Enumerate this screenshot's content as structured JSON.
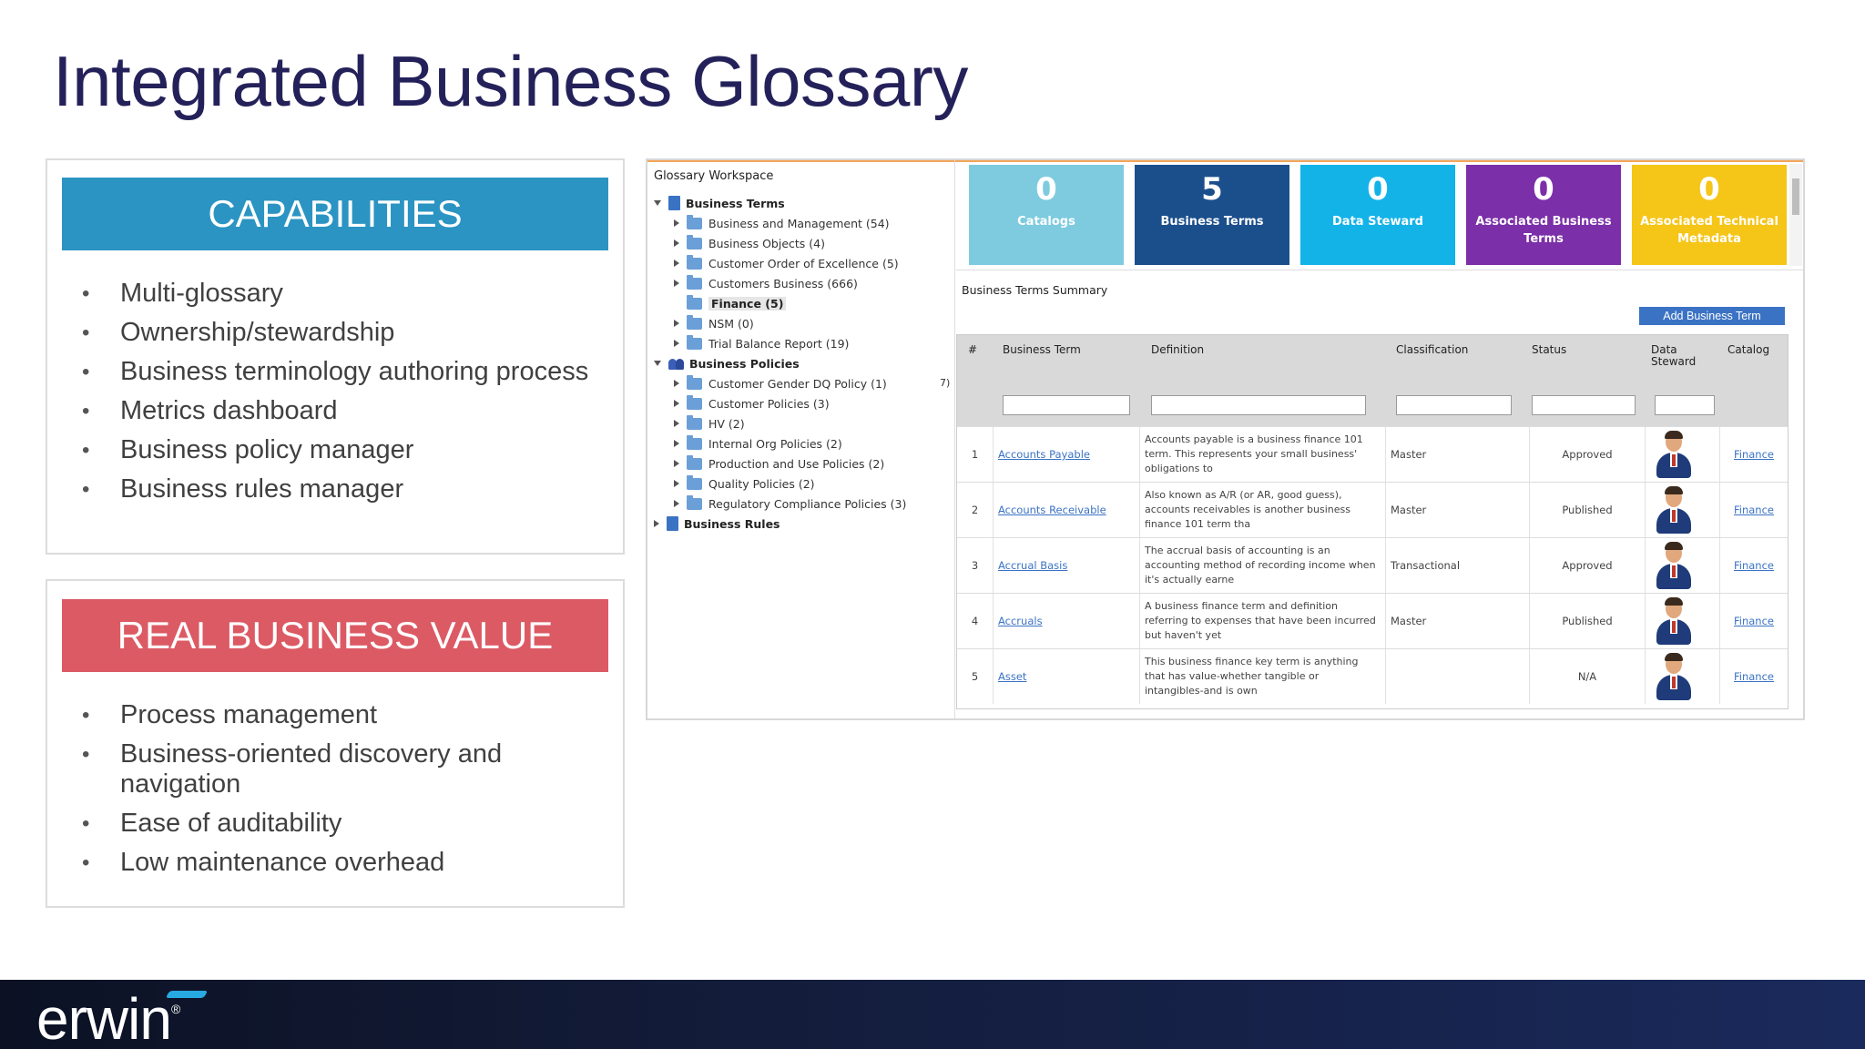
{
  "slide": {
    "title": "Integrated Business Glossary",
    "capabilities": {
      "heading": "CAPABILITIES",
      "color": "#2b94c3",
      "items": [
        "Multi-glossary",
        "Ownership/stewardship",
        "Business terminology authoring process",
        "Metrics dashboard",
        "Business policy manager",
        "Business rules manager"
      ]
    },
    "value": {
      "heading": "REAL BUSINESS VALUE",
      "color": "#dc5a64",
      "items": [
        "Process management",
        "Business-oriented discovery and navigation",
        "Ease of auditability",
        "Low maintenance overhead"
      ]
    },
    "logo": "erwin"
  },
  "app": {
    "tree": {
      "title": "Glossary Workspace",
      "business_terms": {
        "label": "Business Terms",
        "children": [
          "Business and Management (54)",
          "Business Objects (4)",
          "Customer Order of Excellence (5)",
          "Customers Business (666)",
          "Finance (5)",
          "NSM (0)",
          "Trial Balance Report (19)"
        ]
      },
      "business_policies": {
        "label": "Business Policies",
        "children": [
          "Customer Gender DQ Policy (1)",
          "Customer Policies (3)",
          "HV (2)",
          "Internal Org Policies (2)",
          "Production and Use Policies (2)",
          "Quality Policies (2)",
          "Regulatory Compliance Policies (3)"
        ]
      },
      "business_rules": {
        "label": "Business Rules"
      },
      "stray_text": "7)"
    },
    "cards": [
      {
        "count": "0",
        "label": "Catalogs",
        "color": "#7ecbe0"
      },
      {
        "count": "5",
        "label": "Business Terms",
        "color": "#1b4f8c"
      },
      {
        "count": "0",
        "label": "Data Steward",
        "color": "#13b3e8"
      },
      {
        "count": "0",
        "label": "Associated Business Terms",
        "color": "#7b2fa8"
      },
      {
        "count": "0",
        "label": "Associated Technical Metadata",
        "color": "#f5c518"
      }
    ],
    "summary": {
      "title": "Business Terms Summary",
      "add_button": "Add Business Term",
      "columns": {
        "num": "#",
        "term": "Business Term",
        "definition": "Definition",
        "classification": "Classification",
        "status": "Status",
        "steward_line1": "Data",
        "steward_line2": "Steward",
        "catalog": "Catalog"
      },
      "rows": [
        {
          "num": "1",
          "term": "Accounts Payable",
          "definition": "Accounts payable is a business finance 101 term. This represents your small business' obligations to",
          "classification": "Master",
          "status": "Approved",
          "catalog": "Finance"
        },
        {
          "num": "2",
          "term": "Accounts Receivable",
          "definition": "Also known as A/R (or AR, good guess), accounts receivables is another business finance 101 term tha",
          "classification": "Master",
          "status": "Published",
          "catalog": "Finance"
        },
        {
          "num": "3",
          "term": "Accrual Basis",
          "definition": "The accrual basis of accounting is an accounting method of recording income when it's actually earne",
          "classification": "Transactional",
          "status": "Approved",
          "catalog": "Finance"
        },
        {
          "num": "4",
          "term": "Accruals",
          "definition": "A business finance term and definition referring to expenses that have been incurred but haven't yet",
          "classification": "Master",
          "status": "Published",
          "catalog": "Finance"
        },
        {
          "num": "5",
          "term": "Asset",
          "definition": "This business finance key term is anything that has value-whether tangible or intangibles-and is own",
          "classification": "",
          "status": "N/A",
          "catalog": "Finance"
        }
      ]
    }
  }
}
